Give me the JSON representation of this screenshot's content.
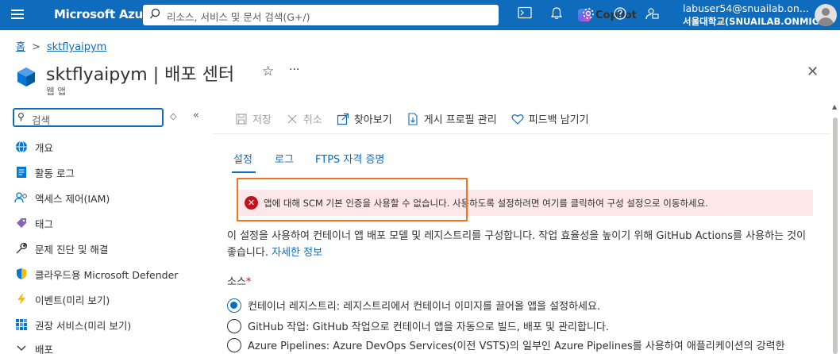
{
  "topbar": {
    "brand": "Microsoft Azure",
    "search_placeholder": "리소스, 서비스 및 문서 검색(G+/)",
    "copilot_label": "Copilot",
    "user_email": "labuser54@snuailab.on...",
    "user_org": "서울대학교(SNUAILAB.ONMIC..."
  },
  "breadcrumb": {
    "home": "홈",
    "resource": "sktflyaipym"
  },
  "page": {
    "title": "sktflyaipym | 배포 센터",
    "subtitle": "웹 앱"
  },
  "nav": {
    "search_placeholder": "검색",
    "items": [
      {
        "label": "개요",
        "icon": "globe-icon"
      },
      {
        "label": "활동 로그",
        "icon": "activity-log-icon"
      },
      {
        "label": "액세스 제어(IAM)",
        "icon": "people-icon"
      },
      {
        "label": "태그",
        "icon": "tag-icon"
      },
      {
        "label": "문제 진단 및 해결",
        "icon": "wrench-icon"
      },
      {
        "label": "클라우드용 Microsoft Defender",
        "icon": "shield-icon"
      },
      {
        "label": "이벤트(미리 보기)",
        "icon": "lightning-icon"
      },
      {
        "label": "권장 서비스(미리 보기)",
        "icon": "grid-icon"
      },
      {
        "label": "배포",
        "icon": "chevron-down-icon"
      }
    ]
  },
  "toolbar": {
    "save": "저장",
    "discard": "취소",
    "browse": "찾아보기",
    "manage_profile": "게시 프로필 관리",
    "feedback": "피드백 남기기"
  },
  "tabs": [
    "설정",
    "로그",
    "FTPS 자격 증명"
  ],
  "banner": {
    "text": "앱에 대해 SCM 기본 인증을 사용할 수 없습니다. 사용하도록 설정하려면 여기를 클릭하여 구성 설정으로 이동하세요."
  },
  "description": {
    "text": "이 설정을 사용하여 컨테이너 앱 배포 모델 및 레지스트리를 구성합니다. 작업 효율성을 높이기 위해 GitHub Actions를 사용하는 것이 좋습니다.",
    "link": "자세한 정보"
  },
  "source": {
    "label": "소스",
    "required_mark": "*",
    "options": [
      {
        "label": "컨테이너 레지스트리: 레지스트리에서 컨테이너 이미지를 끌어올 앱을 설정하세요.",
        "checked": true
      },
      {
        "label": "GitHub 작업: GitHub 작업으로 컨테이너 앱을 자동으로 빌드, 배포 및 관리합니다.",
        "checked": false
      },
      {
        "label": "Azure Pipelines: Azure DevOps Services(이전 VSTS)의 일부인 Azure Pipelines를 사용하여 애플리케이션의 강력한",
        "checked": false
      }
    ]
  },
  "colors": {
    "accent": "#0f6cbd",
    "error": "#c50f1f",
    "error_bg": "#fde7e9",
    "highlight": "#f0731f"
  }
}
